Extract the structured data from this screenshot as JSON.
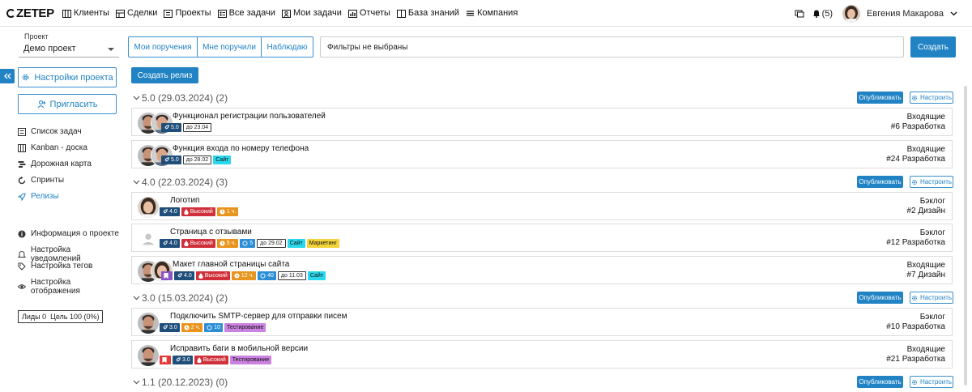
{
  "app": {
    "logo": "ZETEP",
    "nav": [
      "Клиенты",
      "Сделки",
      "Проекты",
      "Все задачи",
      "Мои задачи",
      "Отчеты",
      "База знаний",
      "Компания"
    ],
    "bell_count": "(5)",
    "user_name": "Евгения Макарова"
  },
  "sidebar": {
    "project_label": "Проект",
    "project_value": "Демо проект",
    "settings_btn": "Настройки проекта",
    "invite_btn": "Пригласить",
    "links1": [
      "Список задач",
      "Kanban - доска",
      "Дорожная карта",
      "Спринты",
      "Релизы"
    ],
    "links2": [
      "Информация о проекте",
      "Настройка уведомлений",
      "Настройка тегов",
      "Настройка отображения"
    ],
    "leads": "Лиды 0  Цель 100 (0%)"
  },
  "main": {
    "tabs": [
      "Мои поручения",
      "Мне поручили",
      "Наблюдаю"
    ],
    "filter_text": "Фильтры не выбраны",
    "create_btn": "Создать",
    "create_release_btn": "Создать релиз",
    "publish_label": "Опубликовать",
    "configure_label": "Настроить"
  },
  "groups": [
    {
      "title": "5.0 (29.03.2024) (2)"
    },
    {
      "title": "4.0 (22.03.2024) (3)"
    },
    {
      "title": "3.0 (15.03.2024) (2)"
    },
    {
      "title": "1.1 (20.12.2023) (0)"
    }
  ],
  "tasks": [
    {
      "title": "Функционал регистрации пользователей",
      "status": "Входящие",
      "id": "#6 Разработка",
      "tags": [
        {
          "t": "rel",
          "v": "5.0"
        },
        {
          "t": "due",
          "v": "до 23.04"
        }
      ]
    },
    {
      "title": "Функция входа по номеру телефона",
      "status": "Входящие",
      "id": "#24 Разработка",
      "tags": [
        {
          "t": "rel",
          "v": "5.0"
        },
        {
          "t": "due",
          "v": "до 28.02"
        },
        {
          "t": "site",
          "v": "Сайт"
        }
      ]
    },
    {
      "title": "Логотип",
      "status": "Бэклог",
      "id": "#2 Дизайн",
      "tags": [
        {
          "t": "rel",
          "v": "4.0"
        },
        {
          "t": "high",
          "v": "Высокий"
        },
        {
          "t": "time",
          "v": "1 ч."
        }
      ]
    },
    {
      "title": "Страница с отзывами",
      "status": "Бэклог",
      "id": "#12 Разработка",
      "tags": [
        {
          "t": "rel",
          "v": "4.0"
        },
        {
          "t": "high",
          "v": "Высокий"
        },
        {
          "t": "time",
          "v": "5 ч."
        },
        {
          "t": "sp",
          "v": "5"
        },
        {
          "t": "due",
          "v": "до 29.02"
        },
        {
          "t": "site",
          "v": "Сайт"
        },
        {
          "t": "mkt",
          "v": "Маркетинг"
        }
      ]
    },
    {
      "title": "Макет главной страницы сайта",
      "status": "Входящие",
      "id": "#7 Дизайн",
      "tags": [
        {
          "t": "flag",
          "v": ""
        },
        {
          "t": "rel",
          "v": "4.0"
        },
        {
          "t": "high",
          "v": "Высокий"
        },
        {
          "t": "time",
          "v": "12 ч."
        },
        {
          "t": "sp",
          "v": "40"
        },
        {
          "t": "due",
          "v": "до 11.03"
        },
        {
          "t": "site",
          "v": "Сайт"
        }
      ]
    },
    {
      "title": "Подключить SMTP-сервер для отправки писем",
      "status": "Бэклог",
      "id": "#10 Разработка",
      "tags": [
        {
          "t": "rel",
          "v": "3.0"
        },
        {
          "t": "time",
          "v": "2 ч."
        },
        {
          "t": "sp",
          "v": "10"
        },
        {
          "t": "test",
          "v": "Тестирование"
        }
      ]
    },
    {
      "title": "Исправить баги в мобильной версии",
      "status": "Входящие",
      "id": "#21 Разработка",
      "tags": [
        {
          "t": "flagred",
          "v": ""
        },
        {
          "t": "rel",
          "v": "3.0"
        },
        {
          "t": "high",
          "v": "Высокий"
        },
        {
          "t": "test",
          "v": "Тестирование"
        }
      ]
    }
  ],
  "colors": {
    "accent": "#2183c4",
    "release_tag": "#1f4e7a",
    "priority_high": "#d0303a",
    "time_tag": "#e8951f",
    "site_tag": "#29d8ec",
    "marketing_tag": "#f3d43a",
    "testing_tag": "#cc82e0"
  }
}
